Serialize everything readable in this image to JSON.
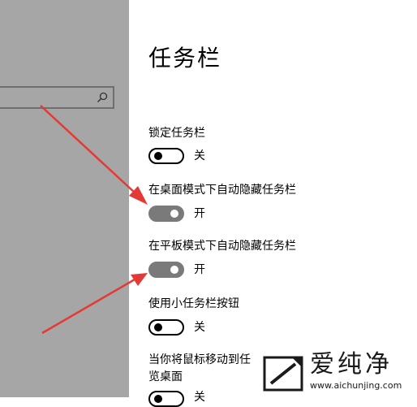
{
  "page": {
    "title": "任务栏"
  },
  "settings": [
    {
      "label": "锁定任务栏",
      "state": "关",
      "on": false
    },
    {
      "label": "在桌面模式下自动隐藏任务栏",
      "state": "开",
      "on": true
    },
    {
      "label": "在平板模式下自动隐藏任务栏",
      "state": "开",
      "on": true
    },
    {
      "label": "使用小任务栏按钮",
      "state": "关",
      "on": false
    },
    {
      "label_line1": "当你将鼠标移动到任",
      "label_line2": "览桌面",
      "state": "关",
      "on": false
    }
  ],
  "watermark": {
    "text": "爱纯净",
    "url": "www.aichunjing.com"
  },
  "colors": {
    "sidebar": "#a6a6a6",
    "toggle_on": "#7a7a7a",
    "arrow": "#e53935"
  },
  "icons": {
    "search": "search-icon"
  }
}
